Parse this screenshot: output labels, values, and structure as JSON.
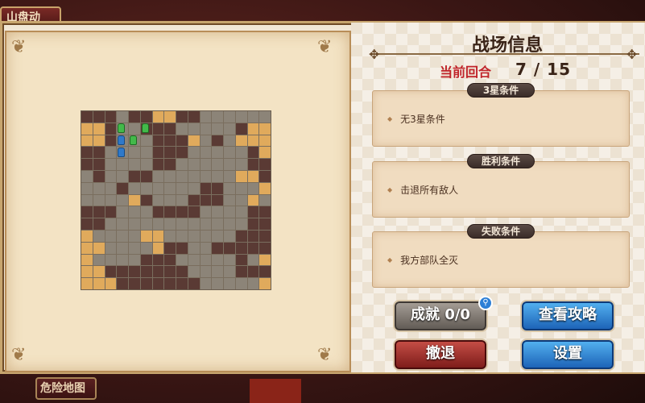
{
  "top_tab": {
    "label": "山盘动"
  },
  "bottom_tab": {
    "label": "危险地图"
  },
  "panel": {
    "title": "战场信息",
    "turn_label": "当前回合",
    "turn_value": "7 / 15"
  },
  "conditions": [
    {
      "header": "3星条件",
      "text": "无3星条件"
    },
    {
      "header": "胜利条件",
      "text": "击退所有敌人"
    },
    {
      "header": "失败条件",
      "text": "我方部队全灭"
    }
  ],
  "buttons": {
    "achievement": "成就 0/0",
    "strategy": "查看攻略",
    "retreat": "撤退",
    "settings": "设置"
  },
  "icons": {
    "achievement_badge": "search-icon"
  },
  "colors": {
    "dark_tile": "#5a3a34",
    "floor_tile": "#8c8478",
    "orange_tile": "#e0aa5c"
  },
  "map": {
    "rows": [
      "dddgddooddgggggg",
      "oodggdddgggggdoo",
      "oodgggdddogdgooo",
      "ddggggdddgggggdo",
      "ddggggddggggggdd",
      "gdggddgggggggood",
      "gggdggggggddgggo",
      "ggggodgggdddggog",
      "dddgggddddggggdd",
      "ddggggggggggggdd",
      "oggggooggggggddd",
      "ooggggoddggddddd",
      "oggggdddgggggdgo",
      "oodddddddggggddd",
      "ooodddddddgggggo"
    ],
    "units": [
      {
        "type": "green",
        "col": 3,
        "row": 1
      },
      {
        "type": "green",
        "col": 5,
        "row": 1
      },
      {
        "type": "blue",
        "col": 3,
        "row": 2
      },
      {
        "type": "green",
        "col": 4,
        "row": 2
      },
      {
        "type": "blue",
        "col": 3,
        "row": 3
      }
    ]
  }
}
